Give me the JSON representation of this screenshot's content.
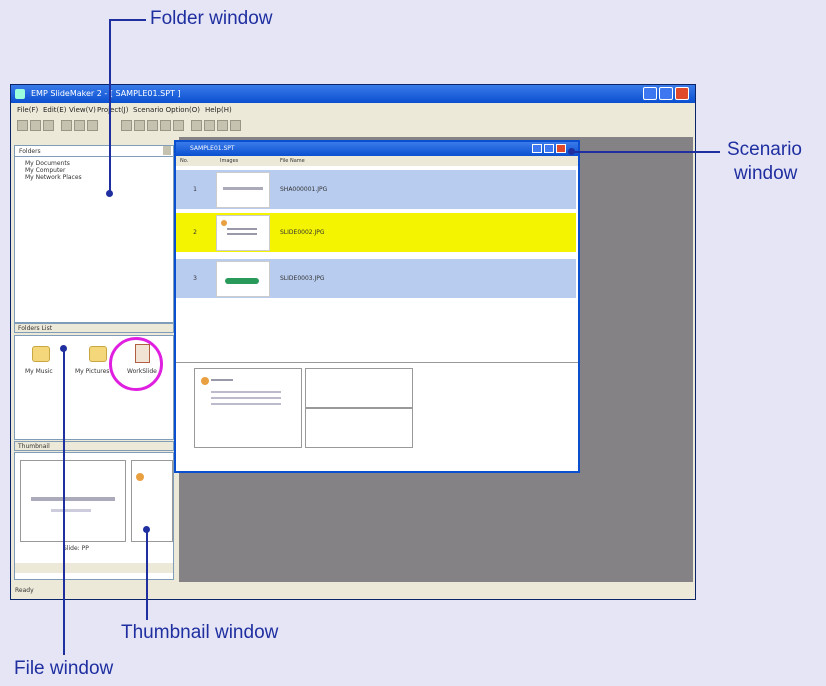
{
  "callouts": {
    "folder_window": "Folder window",
    "scenario_window_line1": "Scenario",
    "scenario_window_line2": "window",
    "thumbnail_window": "Thumbnail window",
    "file_window": "File window"
  },
  "app": {
    "title": "EMP SlideMaker 2 - [ SAMPLE01.SPT ]",
    "menu": [
      "File(F)",
      "Edit(E)",
      "View(V)",
      "Project(J)",
      "Scenario Option(O)",
      "Help(H)"
    ],
    "status": "Ready"
  },
  "folder_pane": {
    "dropdown": "Folders",
    "items": [
      "My Documents",
      "My Computer",
      "My Network Places"
    ]
  },
  "file_pane": {
    "header": "Folders List",
    "items": [
      "My Music",
      "My Pictures",
      "WorkSlide"
    ]
  },
  "thumbnail_pane": {
    "header": "Thumbnail",
    "caption": "Slide: PP"
  },
  "scenario": {
    "title": "SAMPLE01.SPT",
    "columns": [
      "No.",
      "Images",
      "File Name"
    ],
    "rows": [
      {
        "no": "1",
        "file": "SHA000001.JPG"
      },
      {
        "no": "2",
        "file": "SLIDE0002.JPG"
      },
      {
        "no": "3",
        "file": "SLIDE0003.JPG"
      }
    ]
  },
  "colors": {
    "callout": "#1f2fa0",
    "highlight_circle": "#e020e0",
    "row_blue": "#b8ccf0",
    "row_yellow": "#f4f400"
  }
}
